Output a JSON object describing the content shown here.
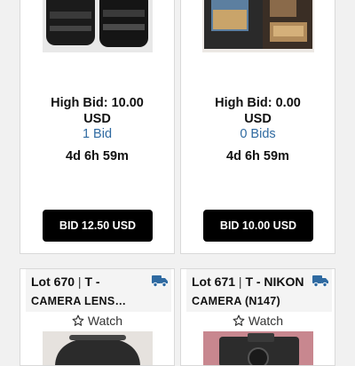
{
  "items": [
    {
      "high_bid": "High Bid: 10.00",
      "currency": "USD",
      "bids": "1 Bid",
      "time_left": "4d 6h 59m",
      "button": "BID 12.50 USD"
    },
    {
      "high_bid": "High Bid: 0.00",
      "currency": "USD",
      "bids": "0 Bids",
      "time_left": "4d 6h 59m",
      "button": "BID 10.00 USD"
    }
  ],
  "lots": [
    {
      "number": "Lot 670",
      "separator": "|",
      "title_start": "T -",
      "title_line2": "CAMERA LENS…",
      "watch": "Watch"
    },
    {
      "number": "Lot 671",
      "separator": "|",
      "title_start": "T - NIKON",
      "title_line2": "CAMERA (N147)",
      "watch": "Watch"
    }
  ],
  "colors": {
    "link": "#2f6aa1",
    "button": "#000000",
    "truck": "#2f6aa1"
  },
  "icons": [
    "truck-icon",
    "star-icon"
  ]
}
